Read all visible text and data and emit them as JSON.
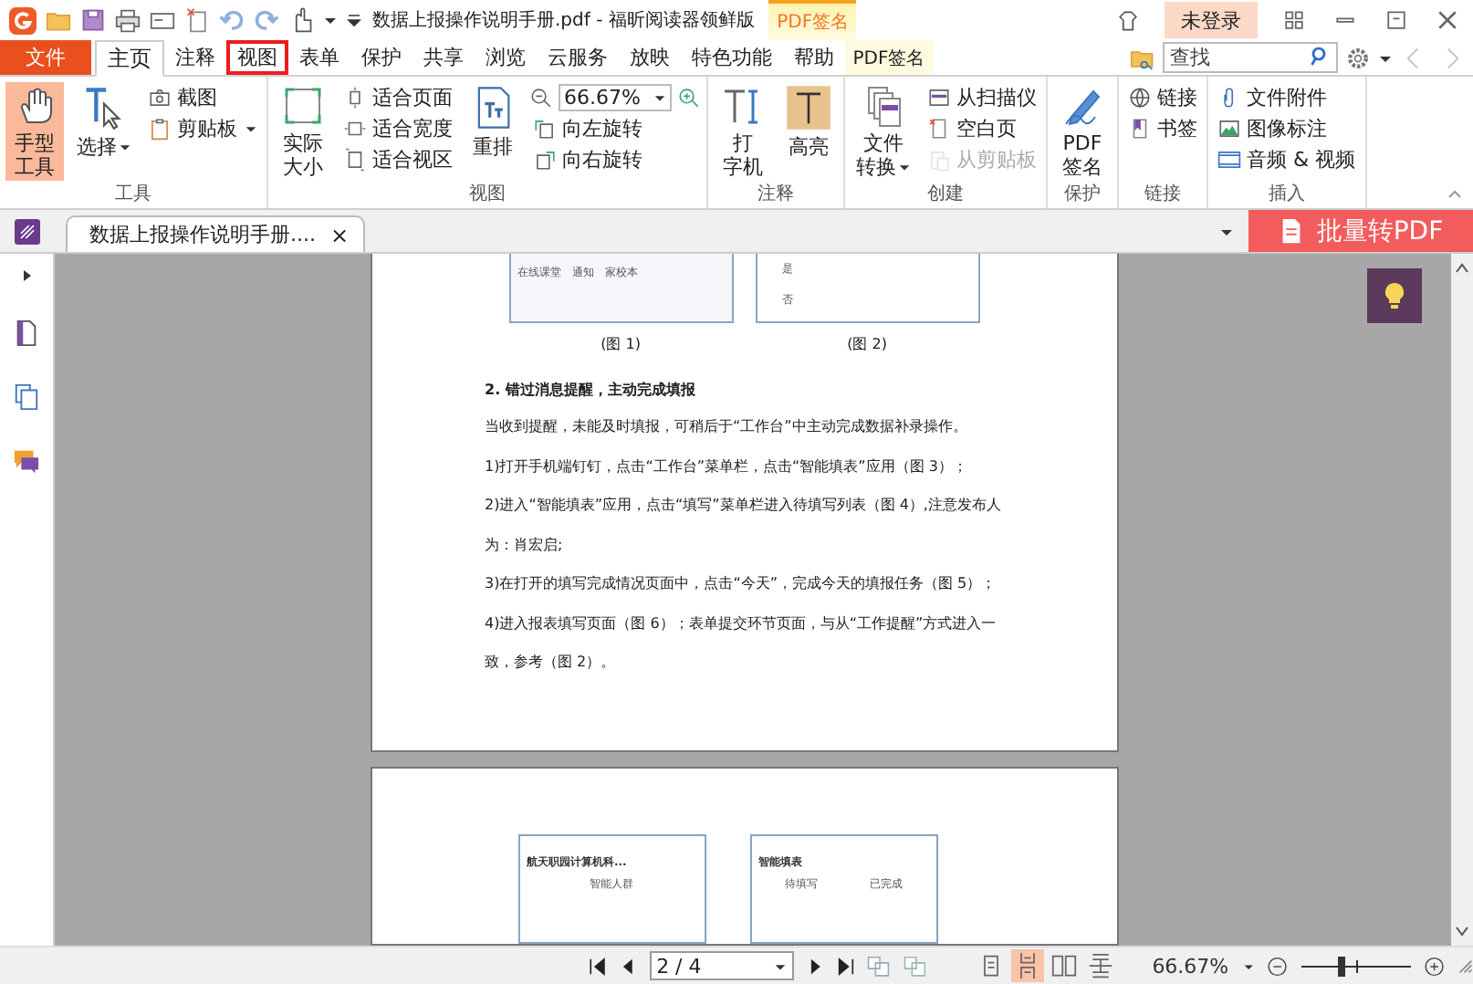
{
  "title_bar": {
    "title": "数据上报操作说明手册.pdf - 福昕阅读器领鲜版",
    "context_label": "PDF签名",
    "login": "未登录"
  },
  "menu_tabs": [
    {
      "label": "文件",
      "kind": "file",
      "selected": false,
      "highlighted": false
    },
    {
      "label": "主页",
      "kind": "tab",
      "selected": true,
      "highlighted": false
    },
    {
      "label": "注释",
      "kind": "tab",
      "selected": false,
      "highlighted": false
    },
    {
      "label": "视图",
      "kind": "tab",
      "selected": false,
      "highlighted": true
    },
    {
      "label": "表单",
      "kind": "tab",
      "selected": false,
      "highlighted": false
    },
    {
      "label": "保护",
      "kind": "tab",
      "selected": false,
      "highlighted": false
    },
    {
      "label": "共享",
      "kind": "tab",
      "selected": false,
      "highlighted": false
    },
    {
      "label": "浏览",
      "kind": "tab",
      "selected": false,
      "highlighted": false
    },
    {
      "label": "云服务",
      "kind": "tab",
      "selected": false,
      "highlighted": false
    },
    {
      "label": "放映",
      "kind": "tab",
      "selected": false,
      "highlighted": false
    },
    {
      "label": "特色功能",
      "kind": "tab",
      "selected": false,
      "highlighted": false
    },
    {
      "label": "帮助",
      "kind": "tab",
      "selected": false,
      "highlighted": false
    },
    {
      "label": "PDF签名",
      "kind": "contextual",
      "selected": false,
      "highlighted": false
    }
  ],
  "search": {
    "placeholder": "查找"
  },
  "ribbon": [
    {
      "label": "工具",
      "columns": [
        [
          {
            "kind": "large",
            "lines": [
              "手型",
              "工具"
            ],
            "active": true,
            "disabled": false,
            "menu": false
          }
        ],
        [
          {
            "kind": "large",
            "lines": [
              "选择"
            ],
            "active": false,
            "disabled": false,
            "menu": true
          }
        ],
        [
          {
            "kind": "small",
            "lines": [
              "截图"
            ],
            "active": false,
            "disabled": false,
            "menu": false
          },
          {
            "kind": "small",
            "lines": [
              "剪贴板"
            ],
            "active": false,
            "disabled": false,
            "menu": true
          }
        ]
      ]
    },
    {
      "label": "视图",
      "columns": [
        [
          {
            "kind": "large",
            "lines": [
              "实际",
              "大小"
            ],
            "active": false,
            "disabled": false,
            "menu": false
          }
        ],
        [
          {
            "kind": "small",
            "lines": [
              "适合页面"
            ],
            "active": false,
            "disabled": false,
            "menu": false
          },
          {
            "kind": "small",
            "lines": [
              "适合宽度"
            ],
            "active": false,
            "disabled": false,
            "menu": false
          },
          {
            "kind": "small",
            "lines": [
              "适合视区"
            ],
            "active": false,
            "disabled": false,
            "menu": false
          }
        ],
        [
          {
            "kind": "large",
            "lines": [
              "重排"
            ],
            "active": false,
            "disabled": false,
            "menu": false
          }
        ],
        [
          {
            "kind": "zoom",
            "lines": [
              "66.67%"
            ]
          },
          {
            "kind": "small",
            "lines": [
              "向左旋转"
            ],
            "active": false,
            "disabled": false,
            "menu": false
          },
          {
            "kind": "small",
            "lines": [
              "向右旋转"
            ],
            "active": false,
            "disabled": false,
            "menu": false
          }
        ]
      ]
    },
    {
      "label": "注释",
      "columns": [
        [
          {
            "kind": "large",
            "lines": [
              "打",
              "字机"
            ],
            "active": false,
            "disabled": false,
            "menu": false
          }
        ],
        [
          {
            "kind": "large",
            "lines": [
              "高亮"
            ],
            "active": false,
            "disabled": false,
            "menu": false
          }
        ]
      ]
    },
    {
      "label": "创建",
      "columns": [
        [
          {
            "kind": "large",
            "lines": [
              "文件",
              "转换"
            ],
            "active": false,
            "disabled": false,
            "menu": true
          }
        ],
        [
          {
            "kind": "small",
            "lines": [
              "从扫描仪"
            ],
            "active": false,
            "disabled": false,
            "menu": false
          },
          {
            "kind": "small",
            "lines": [
              "空白页"
            ],
            "active": false,
            "disabled": false,
            "menu": false
          },
          {
            "kind": "small",
            "lines": [
              "从剪贴板"
            ],
            "active": false,
            "disabled": true,
            "menu": false
          }
        ]
      ]
    },
    {
      "label": "保护",
      "columns": [
        [
          {
            "kind": "large",
            "lines": [
              "PDF",
              "签名"
            ],
            "active": false,
            "disabled": false,
            "menu": false
          }
        ]
      ]
    },
    {
      "label": "链接",
      "columns": [
        [
          {
            "kind": "small",
            "lines": [
              "链接"
            ],
            "active": false,
            "disabled": false,
            "menu": false
          },
          {
            "kind": "small",
            "lines": [
              "书签"
            ],
            "active": false,
            "disabled": false,
            "menu": false
          }
        ]
      ]
    },
    {
      "label": "插入",
      "columns": [
        [
          {
            "kind": "small",
            "lines": [
              "文件附件"
            ],
            "active": false,
            "disabled": false,
            "menu": false
          },
          {
            "kind": "small",
            "lines": [
              "图像标注"
            ],
            "active": false,
            "disabled": false,
            "menu": false
          },
          {
            "kind": "small",
            "lines": [
              "音频 & 视频"
            ],
            "active": false,
            "disabled": false,
            "menu": false
          }
        ]
      ]
    }
  ],
  "document_tab": {
    "title": "数据上报操作说明手册....",
    "close": "×",
    "selected": true
  },
  "batch_button": {
    "label": "批量转PDF"
  },
  "pages": [
    {
      "figures": [
        {
          "caption": "(图 1)",
          "labels": [
            "在线课堂",
            "通知",
            "家校本"
          ]
        },
        {
          "caption": "(图 2)",
          "labels": [
            "是",
            "否"
          ]
        }
      ],
      "heading": "2. 错过消息提醒，主动完成填报",
      "paragraphs": [
        "当收到提醒，未能及时填报，可稍后于“工作台”中主动完成数据补录操作。",
        "1)打开手机端钉钉，点击“工作台”菜单栏，点击“智能填表”应用（图 3）；",
        "2)进入“智能填表”应用，点击“填写”菜单栏进入待填写列表（图 4）,注意发布人为：肖宏启;",
        "3)在打开的填写完成情况页面中，点击“今天”，完成今天的填报任务（图 5）；",
        "4)进入报表填写页面（图 6）；表单提交环节页面，与从“工作提醒”方式进入一致，参考（图 2）。"
      ]
    },
    {
      "figures": [
        {
          "labels": [
            "航天职园计算机科...",
            "智能人群"
          ]
        },
        {
          "labels": [
            "智能填表",
            "待填写",
            "已完成"
          ]
        }
      ]
    }
  ],
  "status_bar": {
    "page": "2 / 4",
    "view_modes": [
      {
        "selected": false
      },
      {
        "selected": true
      },
      {
        "selected": false
      },
      {
        "selected": false
      }
    ],
    "zoom": "66.67%",
    "zoom_slider": {
      "level": 0.33
    }
  }
}
